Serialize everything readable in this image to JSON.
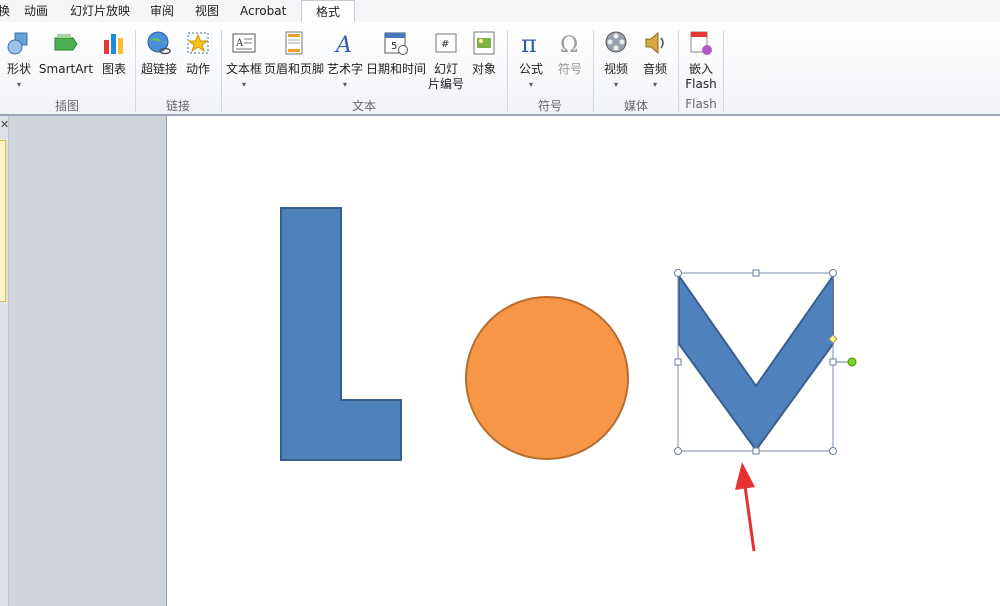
{
  "tabs": [
    {
      "label": "换"
    },
    {
      "label": "动画"
    },
    {
      "label": "幻灯片放映"
    },
    {
      "label": "审阅"
    },
    {
      "label": "视图"
    },
    {
      "label": "Acrobat"
    },
    {
      "label": "格式",
      "active": true
    }
  ],
  "ribbon": {
    "groups": {
      "illustrations": "插图",
      "links": "链接",
      "text": "文本",
      "symbols": "符号",
      "media": "媒体",
      "flash": "Flash"
    },
    "buttons": {
      "shape": "形状",
      "smartart": "SmartArt",
      "chart": "图表",
      "hyperlink": "超链接",
      "action": "动作",
      "textbox": "文本框",
      "header_footer": "页眉和页脚",
      "wordart": "艺术字",
      "datetime": "日期和时间",
      "slide_number_l1": "幻灯",
      "slide_number_l2": "片编号",
      "object": "对象",
      "equation": "公式",
      "symbol": "符号",
      "video": "视频",
      "audio": "音频",
      "embed_flash_l1": "嵌入",
      "embed_flash_l2": "Flash"
    }
  },
  "colors": {
    "shape_blue": "#4f81bd",
    "shape_blue_border": "#3a5f8f",
    "circle_orange": "#f79646",
    "circle_border": "#b66d2e",
    "annotation_red": "#e8312f",
    "handle_green": "#7ed321",
    "handle_yellow": "#ffff66"
  },
  "slide": {
    "shapes": [
      "letter-L",
      "circle",
      "letter-V"
    ],
    "selected": "letter-V"
  }
}
